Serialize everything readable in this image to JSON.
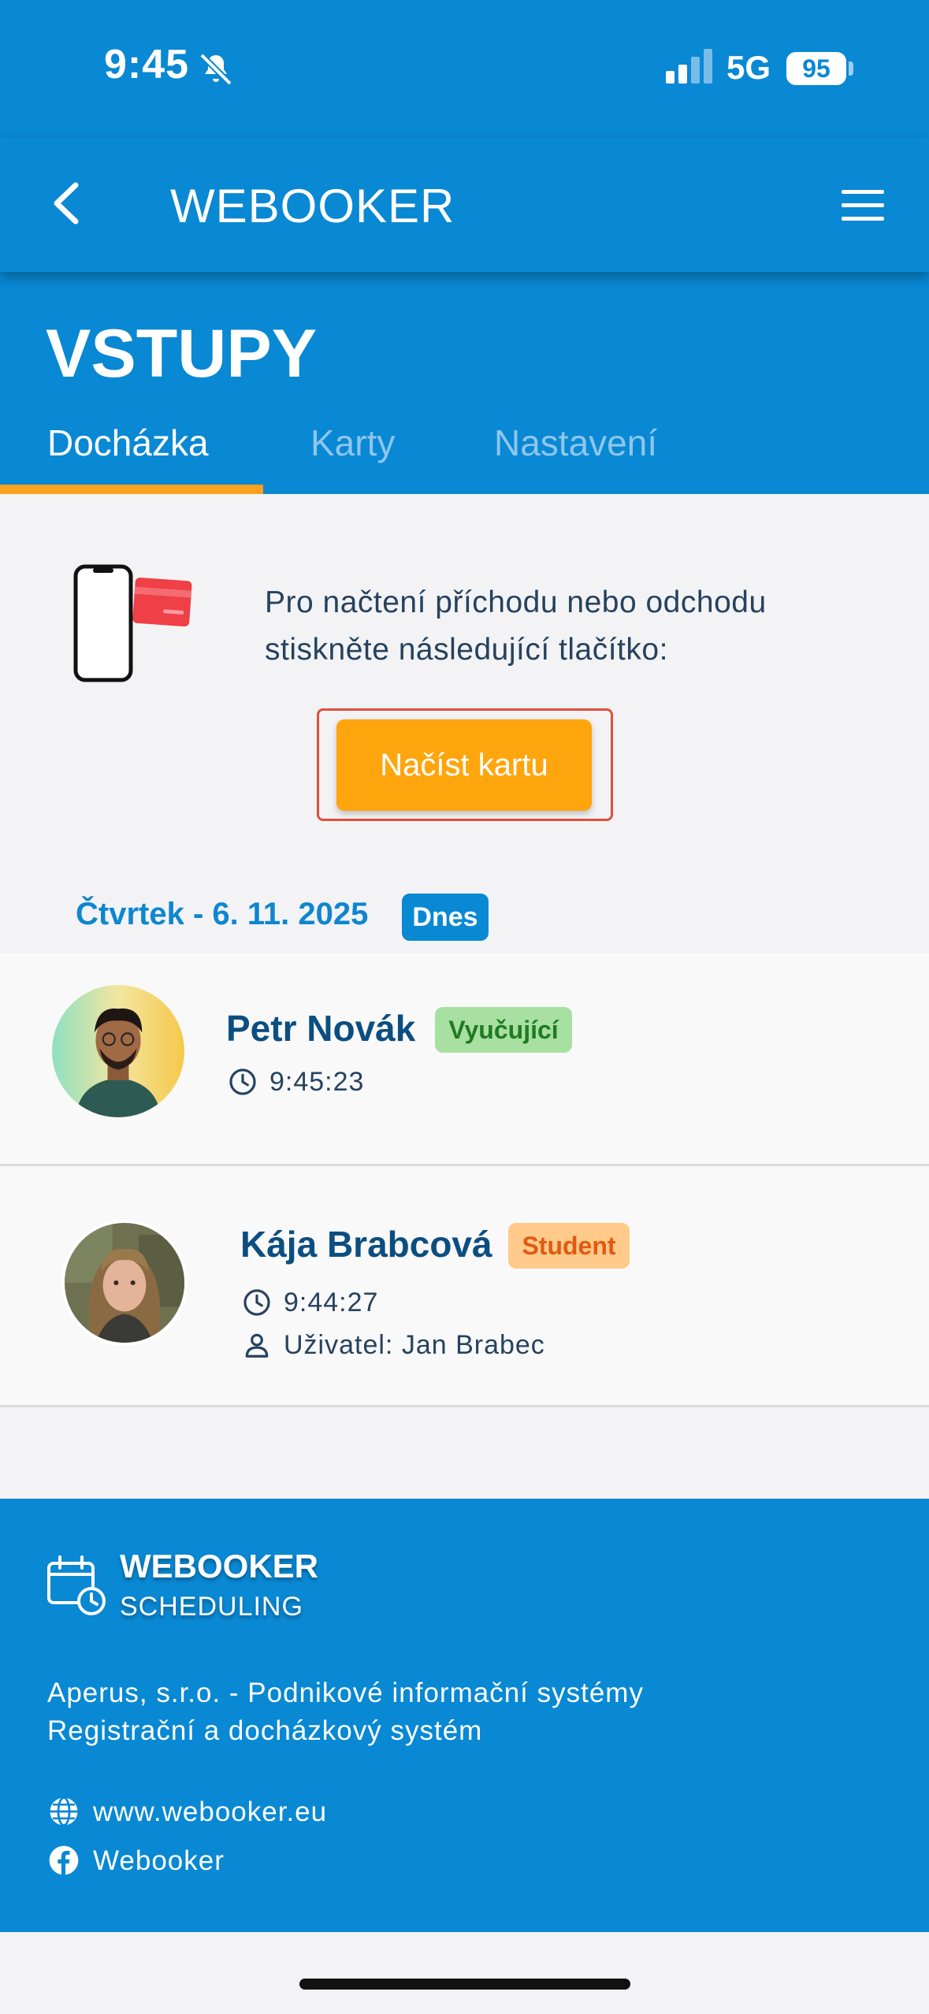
{
  "status_bar": {
    "time": "9:45",
    "network": "5G",
    "battery": "95"
  },
  "app_bar": {
    "title": "WEBOOKER"
  },
  "page": {
    "title": "VSTUPY"
  },
  "tabs": [
    {
      "label": "Docházka"
    },
    {
      "label": "Karty"
    },
    {
      "label": "Nastavení"
    }
  ],
  "reader": {
    "instruction_line1": "Pro načtení příchodu nebo odchodu",
    "instruction_line2": "stiskněte následující tlačítko:",
    "button_label": "Načíst kartu"
  },
  "day": {
    "date": "Čtvrtek - 6. 11. 2025",
    "badge": "Dnes"
  },
  "entries": [
    {
      "name": "Petr Novák",
      "role": "Vyučující",
      "time": "9:45:23"
    },
    {
      "name": "Kája Brabcová",
      "role": "Student",
      "time": "9:44:27",
      "user": "Uživatel: Jan Brabec"
    }
  ],
  "footer": {
    "brand": "WEBOOKER",
    "brand_sub": "SCHEDULING",
    "company": "Aperus, s.r.o. - Podnikové informační systémy",
    "product": "Registrační a docházkový systém",
    "website": "www.webooker.eu",
    "facebook": "Webooker"
  },
  "colors": {
    "primary": "#0988d4",
    "accent": "#fba11d",
    "button": "#ffa50d",
    "teacher_badge": "#a7e0a0",
    "student_badge": "#ffca8a"
  }
}
